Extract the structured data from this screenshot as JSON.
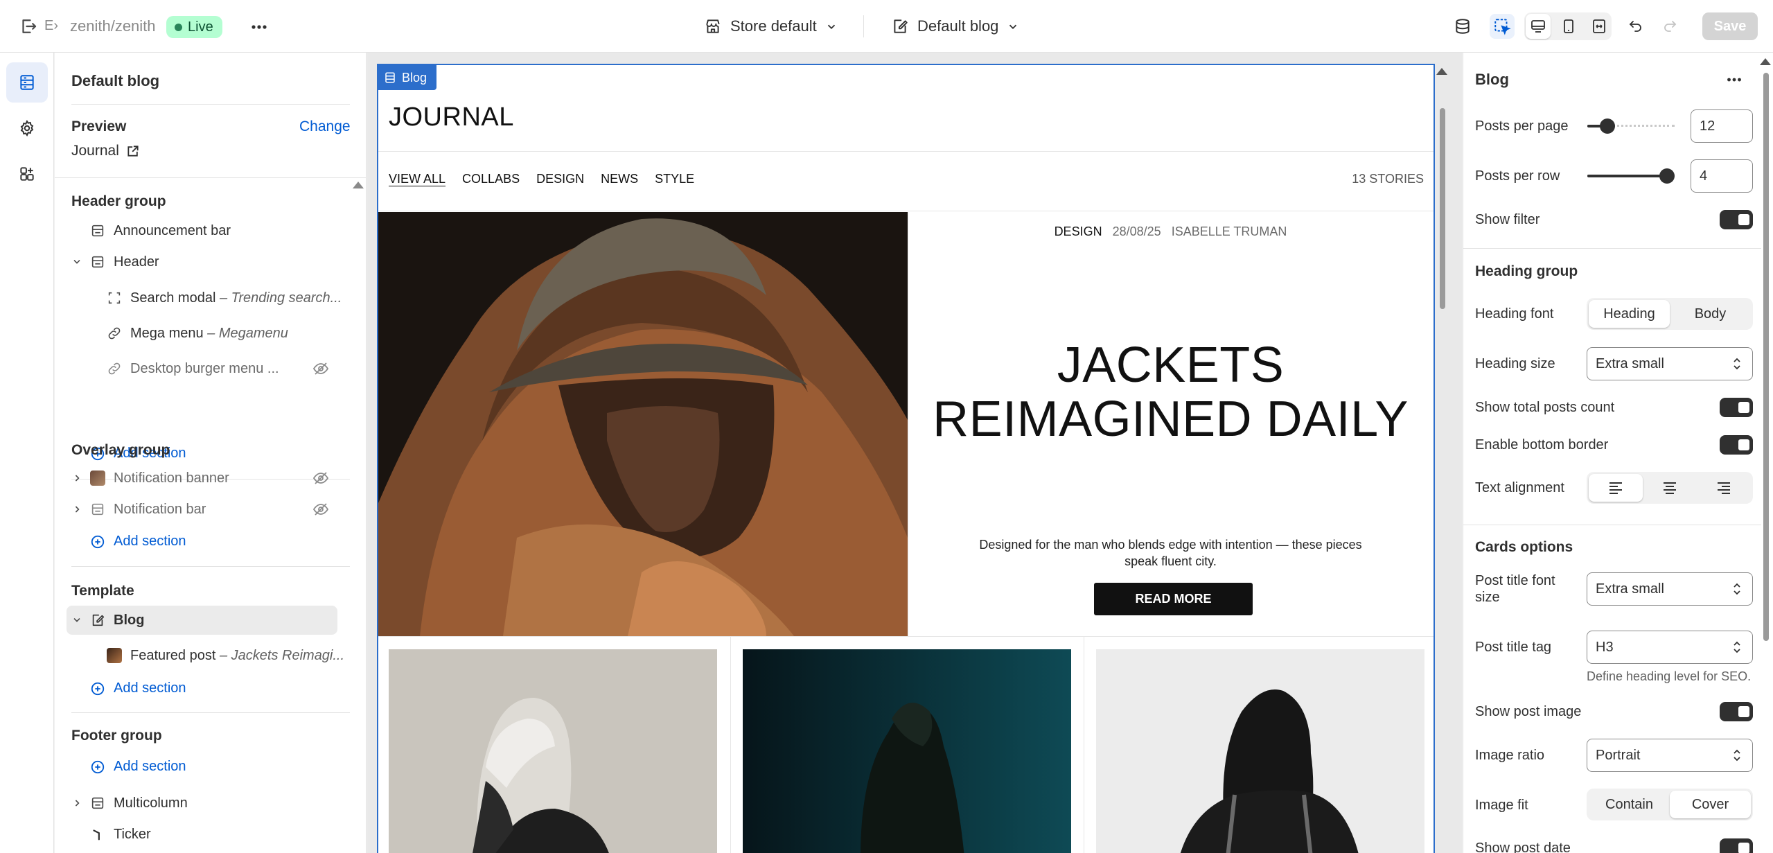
{
  "topbar": {
    "exit_label": "E›",
    "store_name": "zenith/zenith",
    "status_badge": "Live",
    "theme_label": "Store default",
    "page_label": "Default blog",
    "save_label": "Save"
  },
  "left_panel": {
    "title": "Default blog",
    "preview_label": "Preview",
    "change_link": "Change",
    "preview_page": "Journal",
    "header_group": {
      "title": "Header group",
      "items": [
        {
          "label": "Announcement bar"
        },
        {
          "label": "Header"
        },
        {
          "label": "Search modal",
          "sub": " – Trending search..."
        },
        {
          "label": "Mega menu",
          "sub": " – Megamenu"
        },
        {
          "label": "Desktop burger menu ..."
        }
      ],
      "add_section": "Add section"
    },
    "overlay_group": {
      "title": "Overlay group",
      "items": [
        {
          "label": "Notification banner"
        },
        {
          "label": "Notification bar"
        }
      ],
      "add_section": "Add section"
    },
    "template": {
      "title": "Template",
      "items": [
        {
          "label": "Blog"
        },
        {
          "label": "Featured post",
          "sub": " – Jackets Reimagi..."
        }
      ],
      "add_section": "Add section"
    },
    "footer_group": {
      "title": "Footer group",
      "add_section": "Add section",
      "items": [
        {
          "label": "Multicolumn"
        },
        {
          "label": "Ticker"
        }
      ]
    }
  },
  "preview": {
    "section_tag": "Blog",
    "journal_title": "JOURNAL",
    "nav": [
      "VIEW ALL",
      "COLLABS",
      "DESIGN",
      "NEWS",
      "STYLE"
    ],
    "stories_count": "13 STORIES",
    "hero": {
      "category": "DESIGN",
      "date": "28/08/25",
      "author": "ISABELLE TRUMAN",
      "title_line1": "JACKETS",
      "title_line2": "REIMAGINED DAILY",
      "description": "Designed for the man who blends edge with intention — these pieces speak fluent city.",
      "button": "READ MORE"
    }
  },
  "right_panel": {
    "title": "Blog",
    "posts_per_page": {
      "label": "Posts per page",
      "value": "12",
      "slider_fraction": 0.17
    },
    "posts_per_row": {
      "label": "Posts per row",
      "value": "4",
      "slider_fraction": 1.0
    },
    "show_filter": {
      "label": "Show filter",
      "on": true
    },
    "heading_group": {
      "title": "Heading group",
      "heading_font": {
        "label": "Heading font",
        "options": [
          "Heading",
          "Body"
        ],
        "selected": "Heading"
      },
      "heading_size": {
        "label": "Heading size",
        "value": "Extra small"
      },
      "show_total_posts_count": {
        "label": "Show total posts count",
        "on": true
      },
      "enable_bottom_border": {
        "label": "Enable bottom border",
        "on": true
      },
      "text_alignment": {
        "label": "Text alignment",
        "selected": "left"
      }
    },
    "cards_options": {
      "title": "Cards options",
      "post_title_font_size": {
        "label": "Post title font size",
        "value": "Extra small"
      },
      "post_title_tag": {
        "label": "Post title tag",
        "value": "H3",
        "help": "Define heading level for SEO."
      },
      "show_post_image": {
        "label": "Show post image",
        "on": true
      },
      "image_ratio": {
        "label": "Image ratio",
        "value": "Portrait"
      },
      "image_fit": {
        "label": "Image fit",
        "options": [
          "Contain",
          "Cover"
        ],
        "selected": "Cover"
      },
      "show_post_date": {
        "label": "Show post date"
      }
    }
  },
  "colors": {
    "accent_blue": "#2c6ecb",
    "link_blue": "#005bd3",
    "live_badge_bg": "#b4fed2",
    "live_badge_text": "#0c5132",
    "toggle_on": "#303030"
  }
}
